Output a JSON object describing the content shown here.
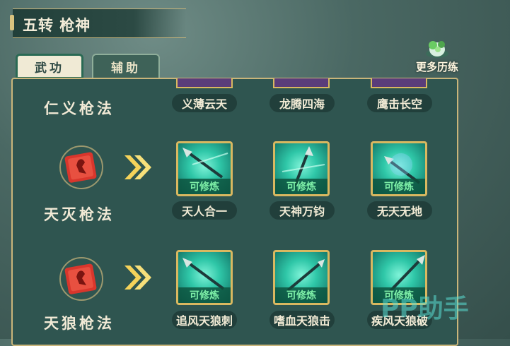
{
  "title": "五转 枪神",
  "tabs": [
    {
      "label": "武功",
      "active": true
    },
    {
      "label": "辅助",
      "active": false
    }
  ],
  "more_training_label": "更多历练",
  "badge_text": "可修炼",
  "rows": [
    {
      "name": "仁义枪法",
      "skills": [
        "义薄云天",
        "龙腾四海",
        "鹰击长空"
      ]
    },
    {
      "name": "天灭枪法",
      "skills": [
        "天人合一",
        "天神万钧",
        "无天无地"
      ]
    },
    {
      "name": "天狼枪法",
      "skills": [
        "追风天狼刺",
        "嗜血天狼击",
        "疾风天狼破"
      ]
    }
  ],
  "watermark": "PP助手",
  "colors": {
    "gold": "#d9b860",
    "panel": "#2f5550",
    "badge_text": "#7ef0a8"
  }
}
